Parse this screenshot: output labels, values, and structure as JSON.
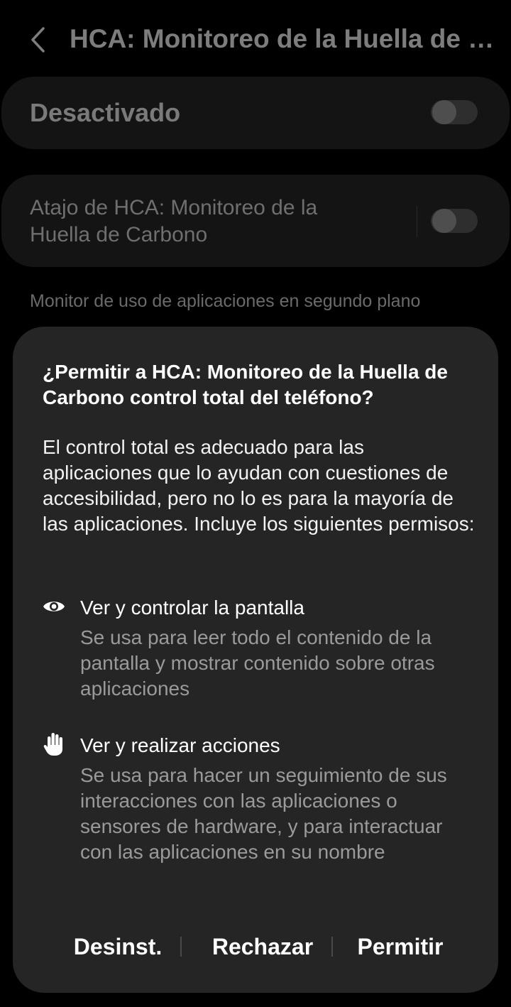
{
  "topbar": {
    "back_icon": "chevron-left-icon",
    "title": "HCA: Monitoreo de la Huella de Carbono"
  },
  "main_card": {
    "label": "Desactivado",
    "toggle_on": false
  },
  "shortcut_card": {
    "label": "Atajo de HCA: Monitoreo de la Huella de Carbono",
    "toggle_on": false
  },
  "section_description": "Monitor de uso de aplicaciones en segundo plano",
  "dialog": {
    "title": "¿Permitir a HCA: Monitoreo de la Huella de Carbono control total del teléfono?",
    "body": "El control total es adecuado para las aplicaciones que lo ayudan con cuestiones de accesibilidad, pero no lo es para la mayoría de las aplicaciones. Incluye los siguientes permisos:",
    "permissions": [
      {
        "icon": "eye-icon",
        "title": "Ver y controlar la pantalla",
        "description": "Se usa para leer todo el contenido de la pantalla y mostrar contenido sobre otras aplicaciones"
      },
      {
        "icon": "hand-icon",
        "title": "Ver y realizar acciones",
        "description": "Se usa para hacer un seguimiento de sus interacciones con las aplicaciones o sensores de hardware, y para interactuar con las aplicaciones en su nombre"
      }
    ],
    "buttons": {
      "uninstall": "Desinst.",
      "deny": "Rechazar",
      "allow": "Permitir"
    }
  },
  "colors": {
    "background": "#000000",
    "card": "#141414",
    "dialog": "#252525",
    "text_primary": "#ffffff",
    "text_secondary": "#9a9a9a"
  }
}
